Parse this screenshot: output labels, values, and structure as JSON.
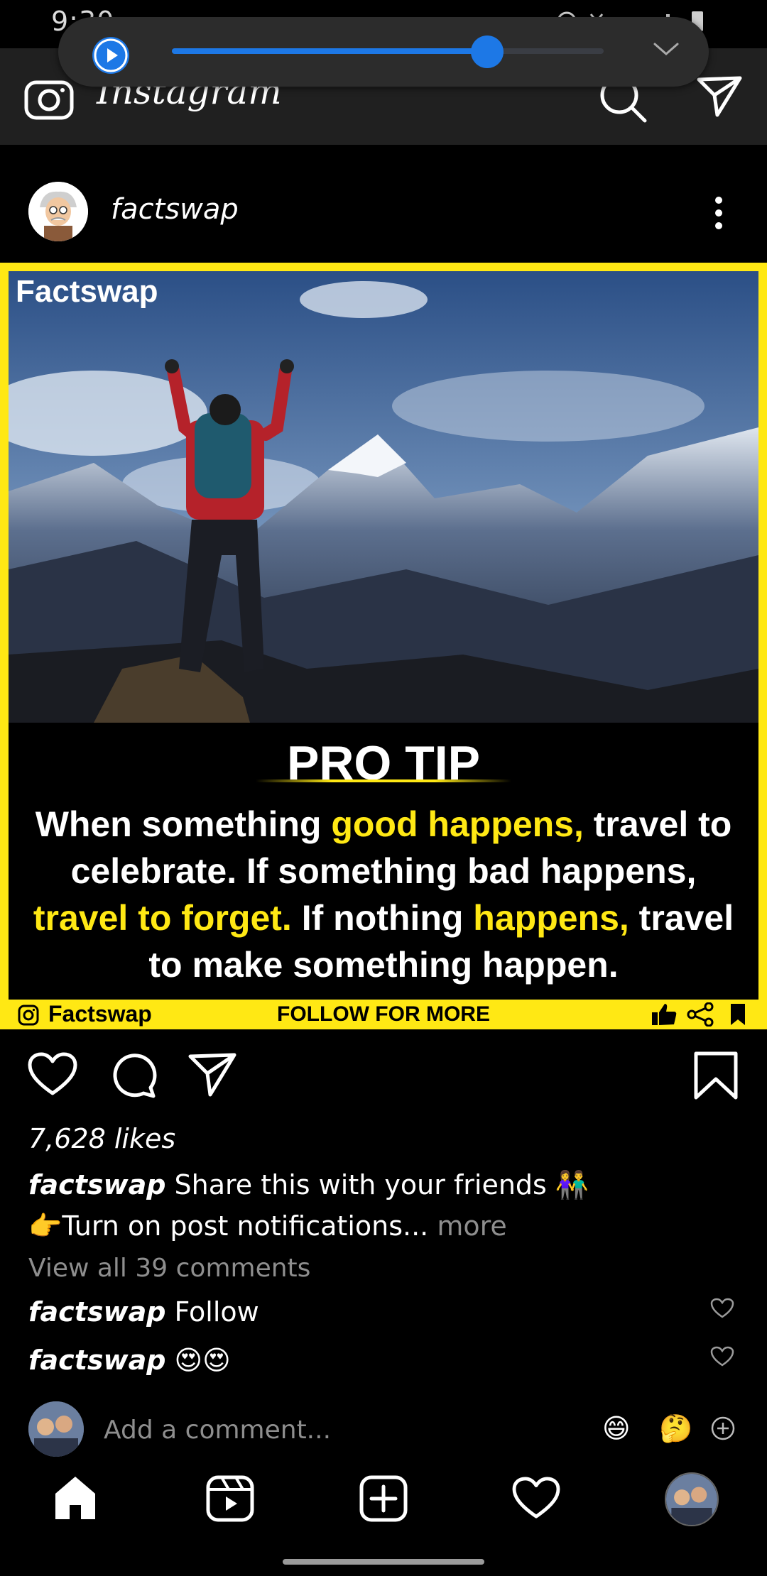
{
  "status_bar": {
    "time": "9:30"
  },
  "media_player": {
    "progress": 0.73
  },
  "top_bar": {
    "wordmark": "Instagram"
  },
  "post": {
    "username": "factswap",
    "image": {
      "label": "Factswap",
      "heading": "PRO TIP",
      "quote_parts": [
        {
          "text": "When something ",
          "highlight": false
        },
        {
          "text": "good happens,",
          "highlight": true
        },
        {
          "text": " travel to celebrate. If something bad happens, ",
          "highlight": false
        },
        {
          "text": "travel to forget.",
          "highlight": true
        },
        {
          "text": " If nothing ",
          "highlight": false
        },
        {
          "text": "happens,",
          "highlight": true
        },
        {
          "text": " travel to make something happen.",
          "highlight": false
        }
      ],
      "footer_brand": "Factswap",
      "footer_cta": "FOLLOW FOR MORE"
    },
    "likes": "7,628 likes",
    "caption_user": "factswap",
    "caption_line1": "Share this with your friends 👫",
    "caption_line2": "👉Turn on post notifications...",
    "caption_more": "more",
    "view_comments": "View all 39 comments",
    "comments": [
      {
        "user": "factswap",
        "text": "Follow"
      },
      {
        "user": "factswap",
        "text": "😍😍"
      }
    ],
    "add_comment_placeholder": "Add a comment...",
    "quick_reactions": [
      "😄",
      "🤔"
    ]
  },
  "colors": {
    "accent": "#ffe814",
    "player_blue": "#1d78e6",
    "topbar": "#202020"
  },
  "icons": {
    "top_bar": [
      "camera-icon",
      "search-icon",
      "direct-message-icon"
    ],
    "post_actions": [
      "heart-icon",
      "comment-icon",
      "share-icon",
      "bookmark-icon"
    ],
    "bottom_nav": [
      "home-icon",
      "reels-icon",
      "create-icon",
      "activity-icon",
      "profile-avatar"
    ]
  }
}
